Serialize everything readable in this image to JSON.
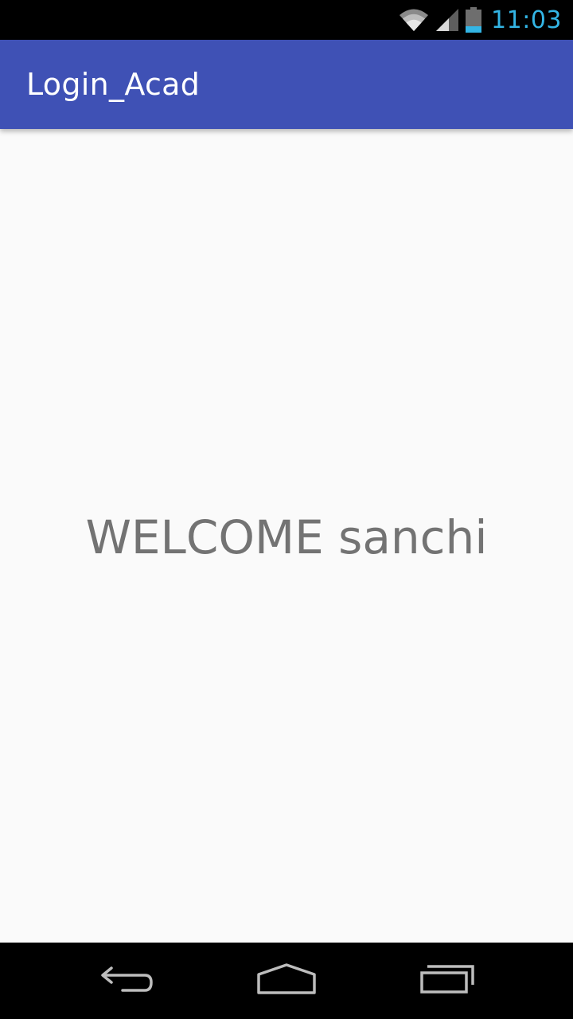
{
  "status_bar": {
    "time": "11:03",
    "icons": [
      "wifi-icon",
      "cell-signal-icon",
      "battery-icon"
    ],
    "time_color": "#33B5E5"
  },
  "app_bar": {
    "title": "Login_Acad",
    "color": "#3F51B5"
  },
  "content": {
    "welcome_message": "WELCOME sanchi"
  },
  "nav_bar": {
    "buttons": [
      "back-icon",
      "home-icon",
      "recents-icon"
    ]
  }
}
